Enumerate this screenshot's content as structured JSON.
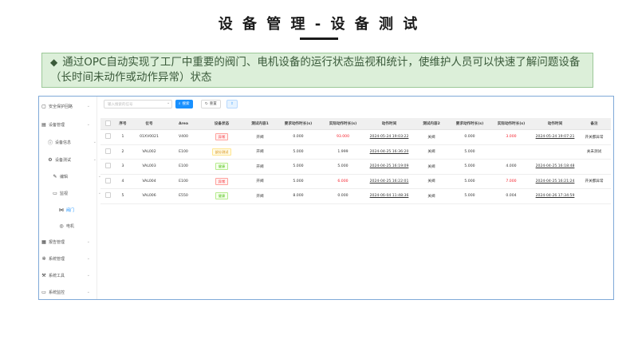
{
  "slide": {
    "title": "设 备 管 理 - 设 备 测 试",
    "banner_bullet": "◆",
    "banner_text": "通过OPC自动实现了工厂中重要的阀门、电机设备的运行状态监视和统计，使维护人员可以快速了解问题设备（长时间未动作或动作异常）状态"
  },
  "sidebar": {
    "items": [
      {
        "label": "安全保护回路",
        "icon": "document-icon"
      },
      {
        "label": "设备管理",
        "icon": "folder-icon"
      },
      {
        "label": "设备信息",
        "icon": "info-icon"
      },
      {
        "label": "设备测试",
        "icon": "test-icon"
      },
      {
        "label": "编辑",
        "icon": "edit-icon"
      },
      {
        "label": "监视",
        "icon": "monitor-icon"
      },
      {
        "label": "阀门",
        "icon": "valve-icon"
      },
      {
        "label": "电机",
        "icon": "motor-icon"
      },
      {
        "label": "报告管理",
        "icon": "report-icon"
      },
      {
        "label": "系统管理",
        "icon": "gear-icon"
      },
      {
        "label": "系统工具",
        "icon": "tool-icon"
      },
      {
        "label": "系统监控",
        "icon": "monitor-icon"
      }
    ]
  },
  "toolbar": {
    "search_placeholder": "输入搜索的信号",
    "search_label": "搜索",
    "reset_label": "重置"
  },
  "table": {
    "columns": [
      "序号",
      "位号",
      "Area",
      "设备状态",
      "测试内容1",
      "要求动作时长(s)",
      "实际动作时长(s)",
      "动作时间",
      "测试内容2",
      "要求动作时长(s)",
      "实际动作时长(s)",
      "动作时间",
      "备注"
    ],
    "rows": [
      {
        "no": "1",
        "tag": "01XV0021",
        "area": "V400",
        "status": "异常",
        "status_color": "red",
        "test1": "开阀",
        "req1": "0.000",
        "act1": "93.000",
        "act1_red": true,
        "time1": "2024-05-24 19:03:22",
        "test2": "关阀",
        "req2": "0.000",
        "act2": "3.000",
        "act2_red": true,
        "time2": "2024-05-24 19:07:21",
        "note": "开关都异常"
      },
      {
        "no": "2",
        "tag": "VAL002",
        "area": "E100",
        "status": "部分测试",
        "status_color": "yellow",
        "test1": "开阀",
        "req1": "5.000",
        "act1": "1.999",
        "act1_red": false,
        "time1": "2024-04-25 16:36:20",
        "test2": "关阀",
        "req2": "5.000",
        "act2": "",
        "act2_red": false,
        "time2": "",
        "note": "关未测试"
      },
      {
        "no": "3",
        "tag": "VAL003",
        "area": "E100",
        "status": "健康",
        "status_color": "green",
        "test1": "开阀",
        "req1": "5.000",
        "act1": "5.000",
        "act1_red": false,
        "time1": "2024-04-25 16:19:09",
        "test2": "关阀",
        "req2": "5.000",
        "act2": "4.000",
        "act2_red": false,
        "time2": "2024-04-25 16:18:48",
        "note": ""
      },
      {
        "no": "4",
        "tag": "VAL004",
        "area": "E100",
        "status": "异常",
        "status_color": "red",
        "test1": "开阀",
        "req1": "5.000",
        "act1": "6.000",
        "act1_red": true,
        "time1": "2024-04-25 16:22:01",
        "test2": "关阀",
        "req2": "5.000",
        "act2": "7.000",
        "act2_red": true,
        "time2": "2024-04-25 16:21:24",
        "note": "开关都异常"
      },
      {
        "no": "5",
        "tag": "VAL006",
        "area": "E550",
        "status": "健康",
        "status_color": "green",
        "test1": "开阀",
        "req1": "8.000",
        "act1": "0.000",
        "act1_red": false,
        "time1": "2024-06-04 11:48:36",
        "test2": "关阀",
        "req2": "5.000",
        "act2": "0.004",
        "act2_red": false,
        "time2": "2024-04-26 17:34:59",
        "note": ""
      }
    ]
  }
}
